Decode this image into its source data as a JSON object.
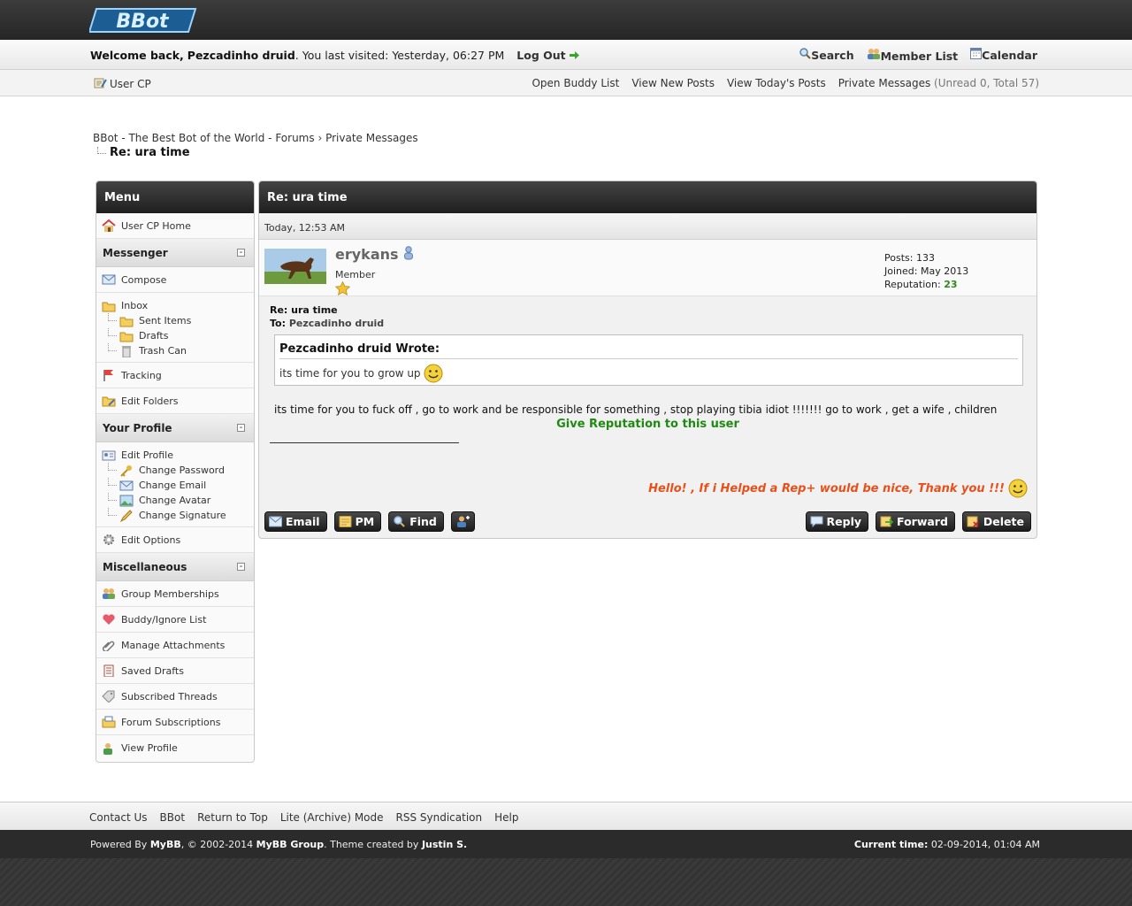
{
  "header": {
    "logo_text": "BBot"
  },
  "welcome": {
    "prefix": "Welcome back,",
    "username": "Pezcadinho druid",
    "last_visit": ". You last visited: Yesterday, 06:27 PM",
    "logout": "Log Out",
    "search": "Search",
    "member_list": "Member List",
    "calendar": "Calendar"
  },
  "subnav": {
    "user_cp": "User CP",
    "open_buddy": "Open Buddy List",
    "new_posts": "View New Posts",
    "todays_posts": "View Today's Posts",
    "pm": "Private Messages",
    "pm_counts": "(Unread 0, Total 57)"
  },
  "breadcrumb": {
    "site": "BBot - The Best Bot of the World - Forums",
    "sep": "›",
    "section": "Private Messages",
    "current": "Re: ura time"
  },
  "menu": {
    "title": "Menu",
    "home": "User CP Home",
    "messenger": {
      "title": "Messenger",
      "compose": "Compose",
      "inbox": "Inbox",
      "sent": "Sent Items",
      "drafts": "Drafts",
      "trash": "Trash Can",
      "tracking": "Tracking",
      "edit_folders": "Edit Folders"
    },
    "profile": {
      "title": "Your Profile",
      "edit_profile": "Edit Profile",
      "change_password": "Change Password",
      "change_email": "Change Email",
      "change_avatar": "Change Avatar",
      "change_signature": "Change Signature",
      "edit_options": "Edit Options"
    },
    "misc": {
      "title": "Miscellaneous",
      "group_memberships": "Group Memberships",
      "buddy_ignore": "Buddy/Ignore List",
      "manage_attachments": "Manage Attachments",
      "saved_drafts": "Saved Drafts",
      "subscribed_threads": "Subscribed Threads",
      "forum_subscriptions": "Forum Subscriptions",
      "view_profile": "View Profile"
    }
  },
  "message": {
    "title": "Re: ura time",
    "date": "Today, 12:53 AM",
    "author": {
      "name": "erykans",
      "title": "Member",
      "posts_label": "Posts:",
      "posts": "133",
      "joined_label": "Joined:",
      "joined": "May 2013",
      "rep_label": "Reputation:",
      "rep": "23"
    },
    "subject": "Re: ura time",
    "to_label": "To:",
    "to": "Pezcadinho druid",
    "quote_header": "Pezcadinho druid Wrote:",
    "quote_text": "its time for you to grow up",
    "text": "its time for you to fuck off , go to work and be responsible for something , stop playing tibia idiot !!!!!!! go to work , get a wife , children",
    "give_rep": "Give Reputation to this user",
    "signature": "Hello! , If i Helped a Rep+ would be nice, Thank you !!!",
    "buttons": {
      "email": "Email",
      "pm": "PM",
      "find": "Find",
      "reply": "Reply",
      "forward": "Forward",
      "delete": "Delete"
    }
  },
  "footer": {
    "contact": "Contact Us",
    "bbot": "BBot",
    "top": "Return to Top",
    "lite": "Lite (Archive) Mode",
    "rss": "RSS Syndication",
    "help": "Help",
    "powered_prefix": "Powered By",
    "mybb": "MyBB",
    "copyright": ", © 2002-2014",
    "mybb_group": "MyBB Group",
    "theme_prefix": ". Theme created by",
    "theme_author": "Justin S.",
    "time_label": "Current time:",
    "time": "02-09-2014, 01:04 AM"
  }
}
